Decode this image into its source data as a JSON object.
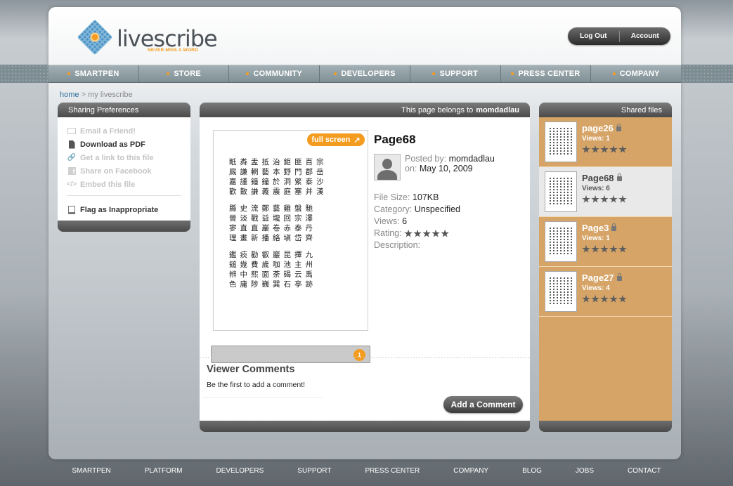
{
  "brand": {
    "name": "livescribe",
    "tagline": "NEVER MISS A WORD",
    "accent_color": "#f39c1f"
  },
  "account": {
    "logout": "Log Out",
    "account": "Account"
  },
  "nav": [
    "SMARTPEN",
    "STORE",
    "COMMUNITY",
    "DEVELOPERS",
    "SUPPORT",
    "PRESS CENTER",
    "COMPANY"
  ],
  "breadcrumb": {
    "home": "home",
    "separator": ">",
    "current": "my livescribe"
  },
  "sharing": {
    "title": "Sharing Preferences",
    "items": [
      {
        "label": "Email a Friend!",
        "icon": "mail-icon",
        "enabled": false
      },
      {
        "label": "Download as PDF",
        "icon": "document-icon",
        "enabled": true
      },
      {
        "label": "Get a link to this file",
        "icon": "link-icon",
        "enabled": false
      },
      {
        "label": "Share on Facebook",
        "icon": "facebook-icon",
        "enabled": false
      },
      {
        "label": "Embed this file",
        "icon": "code-icon",
        "enabled": false
      }
    ],
    "flag": "Flag as Inappropriate"
  },
  "page": {
    "owner_prefix": "This page belongs to",
    "owner": "momdadlau",
    "fullscreen": "full screen",
    "page_number": "1",
    "title": "Page68",
    "posted_by_label": "Posted by:",
    "posted_by": "momdadlau",
    "on_label": "on:",
    "date": "May 10, 2009",
    "file_size_label": "File Size:",
    "file_size": "107KB",
    "category_label": "Category:",
    "category": "Unspecified",
    "views_label": "Views:",
    "views": "6",
    "rating_label": "Rating:",
    "rating": 5,
    "description_label": "Description:",
    "handwriting_rows": [
      "眡粦盂抵治鉅匪百宗",
      "廐謙輞藝本野門郡岳",
      "嘉謹鐘鐘於洞綮泰沙",
      "歡散謙義震庭塞并漢",
      "",
      "縣史流鄭藝雞盤馳",
      "晉淡戰益壠回宗澤",
      "寥直直巖卷赤泰丹",
      "理畫新播絡塡岱齊",
      "",
      "鑑痰勸叡巖昆擇九",
      "鎚幾費歲咖池主州",
      "辨中熙面荼碣云禹",
      "色庸陟巍巽石亭跡"
    ]
  },
  "comments": {
    "title": "Viewer Comments",
    "empty_text": "Be the first to add a comment!",
    "add_button": "Add a Comment"
  },
  "shared_files": {
    "title": "Shared files",
    "views_label": "Views:",
    "items": [
      {
        "name": "page26",
        "views": "1",
        "rating": 5,
        "selected": false
      },
      {
        "name": "Page68",
        "views": "6",
        "rating": 5,
        "selected": true
      },
      {
        "name": "Page3",
        "views": "1",
        "rating": 5,
        "selected": false
      },
      {
        "name": "Page27",
        "views": "4",
        "rating": 5,
        "selected": false
      }
    ]
  },
  "footer": [
    "SMARTPEN",
    "PLATFORM",
    "DEVELOPERS",
    "SUPPORT",
    "PRESS CENTER",
    "COMPANY",
    "BLOG",
    "JOBS",
    "CONTACT"
  ]
}
